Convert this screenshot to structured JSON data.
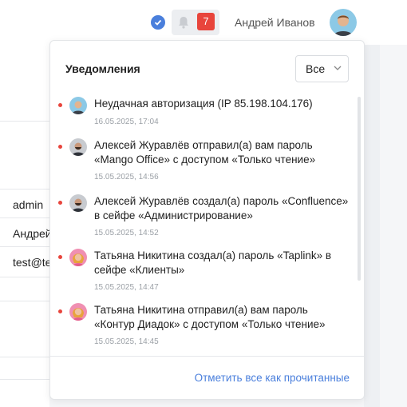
{
  "header": {
    "notification_count": "7",
    "user_name": "Андрей Иванов"
  },
  "background": {
    "cells": [
      "admin",
      "Андрей",
      "test@te"
    ]
  },
  "notifications_panel": {
    "title": "Уведомления",
    "filter_value": "Все",
    "mark_all_read": "Отметить все как прочитанные",
    "items": [
      {
        "avatar": "blue",
        "text": "Неудачная авторизация (IP 85.198.104.176)",
        "date": "16.05.2025, 17:04"
      },
      {
        "avatar": "gray",
        "text": "Алексей Журавлёв отправил(а) вам пароль «Mango Office» с доступом «Только чтение»",
        "date": "15.05.2025, 14:56"
      },
      {
        "avatar": "gray",
        "text": "Алексей Журавлёв создал(а) пароль «Confluence» в сейфе «Администрирование»",
        "date": "15.05.2025, 14:52"
      },
      {
        "avatar": "pink",
        "text": "Татьяна Никитина создал(а) пароль «Taplink» в сейфе «Клиенты»",
        "date": "15.05.2025, 14:47"
      },
      {
        "avatar": "pink",
        "text": "Татьяна Никитина отправил(а) вам пароль «Контур Диадок» с доступом «Только чтение»",
        "date": "15.05.2025, 14:45"
      }
    ]
  },
  "colors": {
    "accent": "#4a7fdc",
    "unread": "#e8453c"
  }
}
